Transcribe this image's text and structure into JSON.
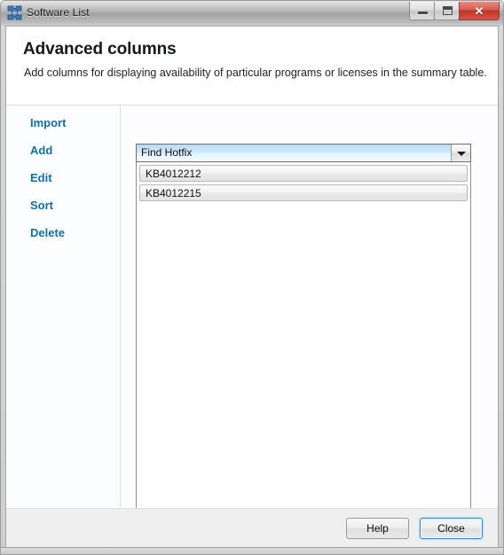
{
  "window": {
    "title": "Software List",
    "icon": "software-network-icon",
    "controls": {
      "minimize": "minimize",
      "restore": "restore",
      "close": "✕"
    }
  },
  "header": {
    "title": "Advanced columns",
    "subtitle": "Add columns for displaying availability of particular programs or licenses in the summary table."
  },
  "sidebar": {
    "items": [
      {
        "label": "Import"
      },
      {
        "label": "Add"
      },
      {
        "label": "Edit"
      },
      {
        "label": "Sort"
      },
      {
        "label": "Delete"
      }
    ]
  },
  "content": {
    "combo": {
      "selected": "Find Hotfix",
      "arrow_icon": "chevron-down-icon"
    },
    "list": [
      {
        "label": "KB4012212"
      },
      {
        "label": "KB4012215"
      }
    ]
  },
  "footer": {
    "help_label": "Help",
    "close_label": "Close"
  },
  "colors": {
    "link": "#0f6fa8",
    "combo_highlight": "#cfe9f9",
    "close_button_red": "#bf3327",
    "default_button_focus": "#2e8bd0"
  }
}
